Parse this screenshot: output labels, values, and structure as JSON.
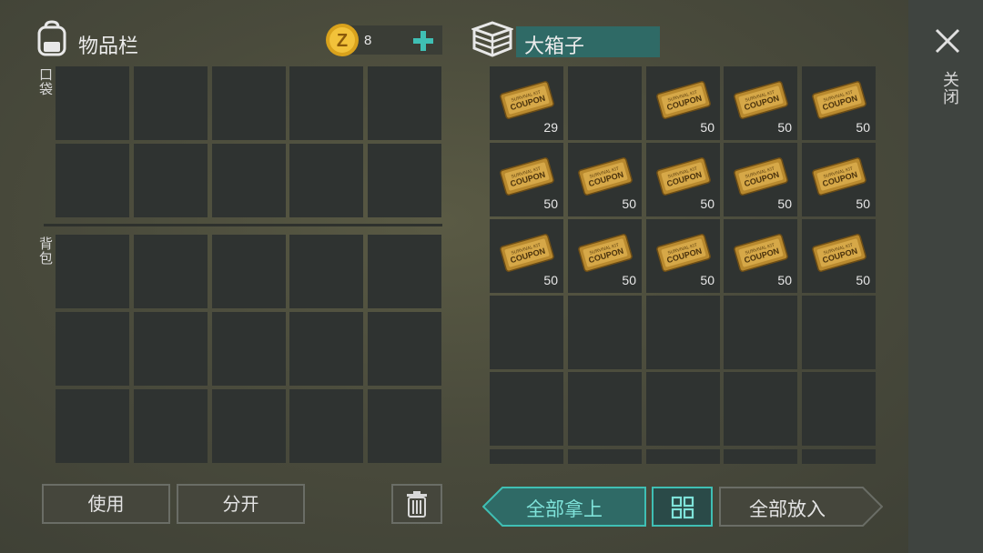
{
  "colors": {
    "accent": "#3fbfb4",
    "cell_bg": "#2f3331",
    "side_panel": "#3f4440"
  },
  "inventory": {
    "title": "物品栏",
    "icon": "backpack-icon",
    "pocket_label": "口袋",
    "backpack_label": "背包"
  },
  "currency": {
    "icon": "coin-icon",
    "value": "8",
    "add_icon": "plus-icon"
  },
  "container": {
    "icon": "crate-icon",
    "name": "大箱子"
  },
  "close": {
    "label": "关闭",
    "icon": "close-x-icon"
  },
  "container_slots": [
    {
      "item": "survival-kit-coupon",
      "qty": "29"
    },
    {
      "item": null,
      "qty": ""
    },
    {
      "item": "survival-kit-coupon",
      "qty": "50"
    },
    {
      "item": "survival-kit-coupon",
      "qty": "50"
    },
    {
      "item": "survival-kit-coupon",
      "qty": "50"
    },
    {
      "item": "survival-kit-coupon",
      "qty": "50"
    },
    {
      "item": "survival-kit-coupon",
      "qty": "50"
    },
    {
      "item": "survival-kit-coupon",
      "qty": "50"
    },
    {
      "item": "survival-kit-coupon",
      "qty": "50"
    },
    {
      "item": "survival-kit-coupon",
      "qty": "50"
    },
    {
      "item": "survival-kit-coupon",
      "qty": "50"
    },
    {
      "item": "survival-kit-coupon",
      "qty": "50"
    },
    {
      "item": "survival-kit-coupon",
      "qty": "50"
    },
    {
      "item": "survival-kit-coupon",
      "qty": "50"
    },
    {
      "item": "survival-kit-coupon",
      "qty": "50"
    }
  ],
  "buttons": {
    "use": "使用",
    "split": "分开",
    "trash_icon": "trash-icon",
    "take_all": "全部拿上",
    "sort_icon": "grid-sort-icon",
    "put_all": "全部放入"
  }
}
